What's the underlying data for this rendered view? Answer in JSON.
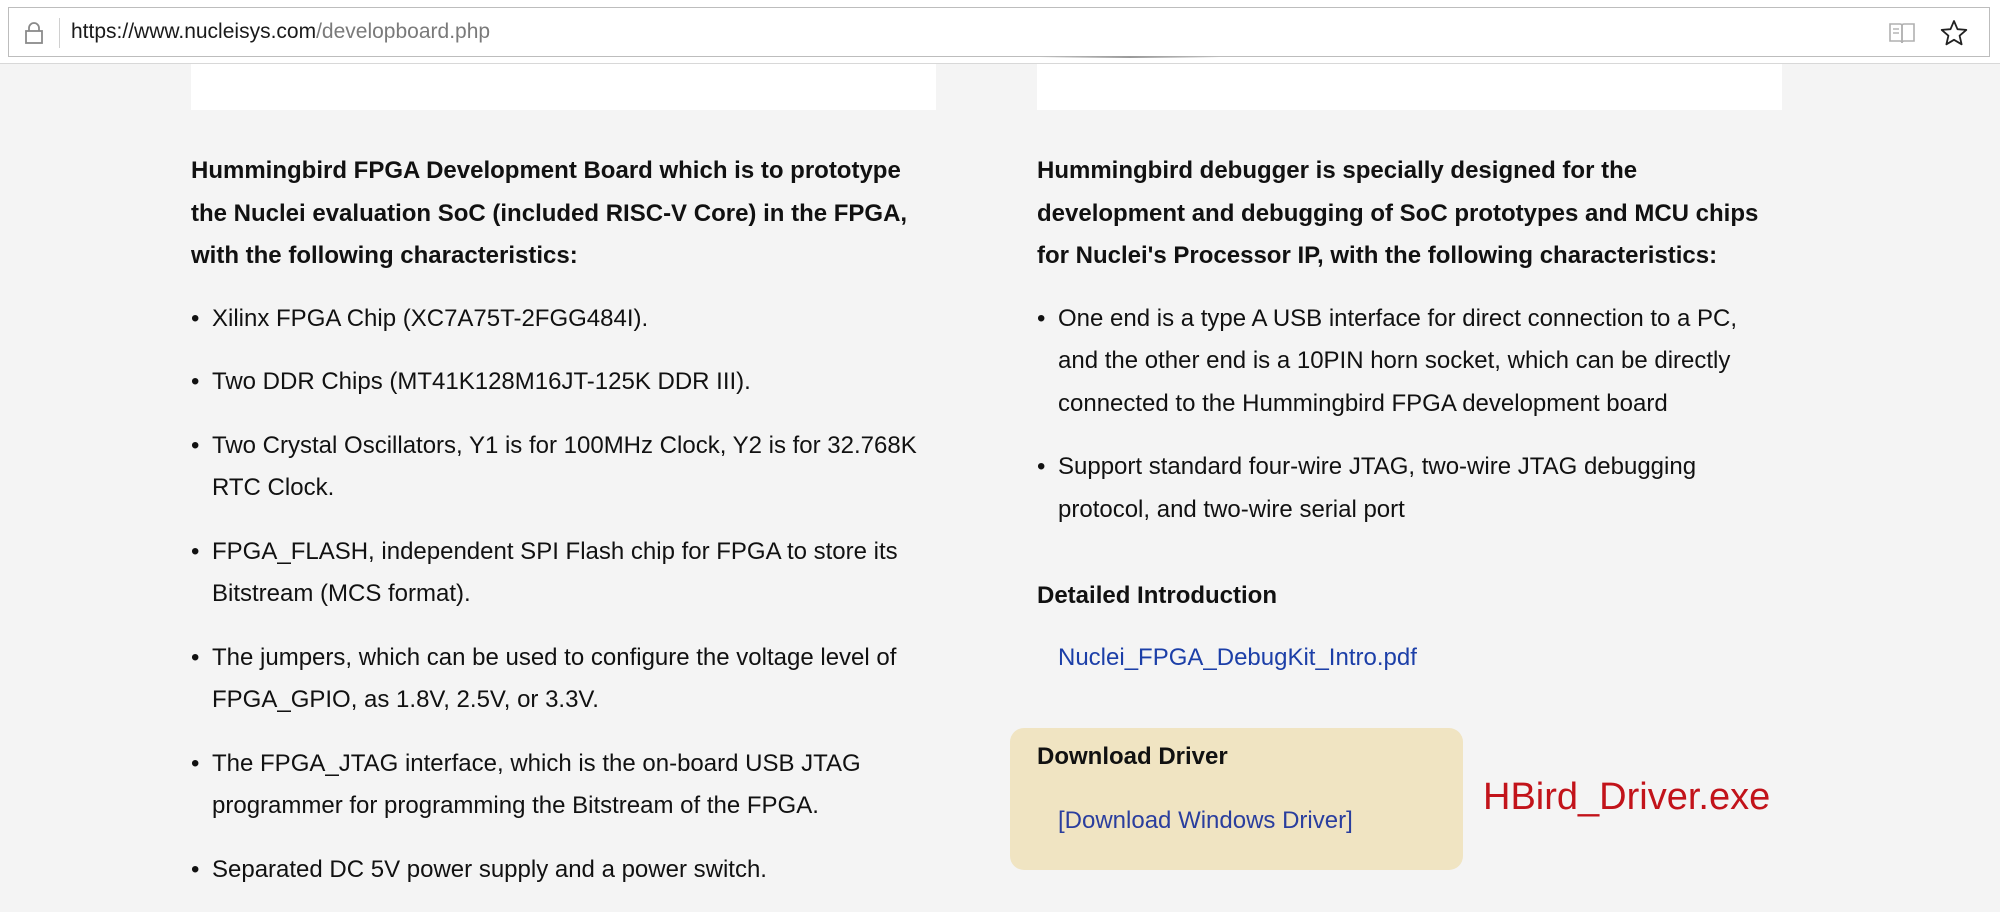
{
  "browser": {
    "url_host": "https://www.nucleisys.com",
    "url_path": "/developboard.php",
    "lock_icon": "lock-icon",
    "reader_icon": "reading-view-icon",
    "star_icon": "favorite-star-icon"
  },
  "left_column": {
    "intro": "Hummingbird FPGA Development Board which is to prototype the Nuclei evaluation SoC (included RISC-V Core) in the FPGA, with the following characteristics:",
    "features": [
      "Xilinx FPGA Chip (XC7A75T-2FGG484I).",
      "Two DDR Chips (MT41K128M16JT-125K DDR III).",
      "Two Crystal Oscillators, Y1 is for 100MHz Clock, Y2 is for 32.768K RTC Clock.",
      "FPGA_FLASH, independent SPI Flash chip for FPGA to store its Bitstream (MCS format).",
      "The jumpers, which can be used to configure the voltage level of FPGA_GPIO, as 1.8V, 2.5V, or 3.3V.",
      "The FPGA_JTAG interface, which is the on-board USB JTAG programmer for programming the Bitstream of the FPGA.",
      "Separated DC 5V power supply and a power switch."
    ]
  },
  "right_column": {
    "intro": "Hummingbird debugger is specially designed for the development and debugging of SoC prototypes and MCU chips for Nuclei's Processor IP, with the following characteristics:",
    "features": [
      "One end is a type A USB interface for direct connection to a PC, and the other end is a 10PIN horn socket, which can be directly connected to the Hummingbird FPGA development board",
      "Support standard four-wire JTAG, two-wire JTAG debugging protocol, and two-wire serial port"
    ],
    "detailed_heading": "Detailed Introduction",
    "pdf_link": "Nuclei_FPGA_DebugKit_Intro.pdf"
  },
  "download": {
    "title": "Download Driver",
    "link": "[Download Windows Driver]",
    "note": "HBird_Driver.exe"
  },
  "bullet": "•",
  "colors": {
    "link": "#1c3fa8",
    "driver_box_bg": "#f0e4c2",
    "note_red": "#c2131a"
  }
}
